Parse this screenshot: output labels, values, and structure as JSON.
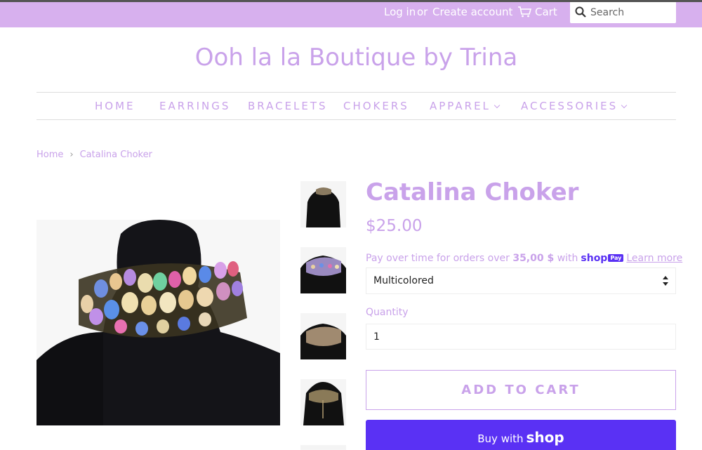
{
  "header": {
    "login": "Log in",
    "or": "or",
    "create_account": "Create account",
    "cart": "Cart",
    "search_placeholder": "Search"
  },
  "store": {
    "name": "Ooh la la Boutique by Trina"
  },
  "nav": {
    "items": [
      {
        "label": "HOME",
        "dropdown": false
      },
      {
        "label": "EARRINGS",
        "dropdown": false
      },
      {
        "label": "BRACELETS",
        "dropdown": false
      },
      {
        "label": "CHOKERS",
        "dropdown": false
      },
      {
        "label": "APPAREL",
        "dropdown": true
      },
      {
        "label": "ACCESSORIES",
        "dropdown": true
      }
    ]
  },
  "breadcrumb": {
    "home": "Home",
    "sep": "›",
    "current": "Catalina Choker"
  },
  "product": {
    "title": "Catalina Choker",
    "price": "$25.00",
    "installments_pre": "Pay over time for orders over",
    "installments_amount": "35,00 $",
    "installments_post": "with",
    "shoppay_word": "shop",
    "shoppay_badge": "Pay",
    "learn_more": "Learn more",
    "variant": "Multicolored",
    "quantity_label": "Quantity",
    "quantity": "1",
    "add_to_cart": "ADD TO CART",
    "buy_with": "Buy with",
    "buy_shop": "shop"
  },
  "colors": {
    "accent": "#c9a2ea",
    "topbar": "#d7b0ee",
    "shop_purple": "#5a31f4"
  }
}
